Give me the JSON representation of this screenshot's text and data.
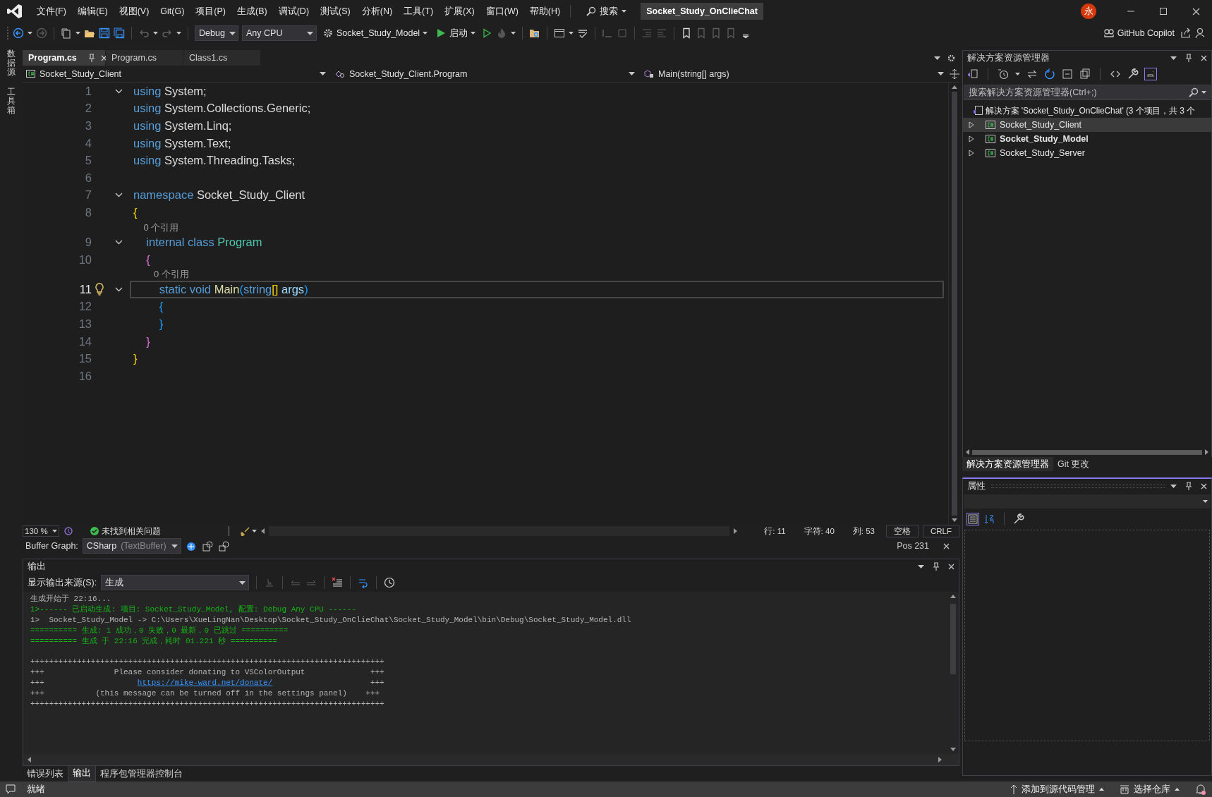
{
  "titlebar": {
    "menu": [
      "文件(F)",
      "编辑(E)",
      "视图(V)",
      "Git(G)",
      "项目(P)",
      "生成(B)",
      "调试(D)",
      "测试(S)",
      "分析(N)",
      "工具(T)",
      "扩展(X)",
      "窗口(W)",
      "帮助(H)"
    ],
    "search": "搜索",
    "title": "Socket_Study_OnClieChat",
    "avatar": "永"
  },
  "toolbar": {
    "configuration": "Debug",
    "platform": "Any CPU",
    "startup_project": "Socket_Study_Model",
    "start": "启动",
    "copilot": "GitHub Copilot"
  },
  "side_tabs": [
    "数据源",
    "工具箱"
  ],
  "doc_tabs": [
    {
      "label": "Program.cs",
      "selected": true
    },
    {
      "label": "Program.cs",
      "selected": false
    },
    {
      "label": "Class1.cs",
      "selected": false
    }
  ],
  "nav": {
    "project": "Socket_Study_Client",
    "type": "Socket_Study_Client.Program",
    "member": "Main(string[] args)"
  },
  "editor": {
    "lines": [
      {
        "kind": "code",
        "number": "1",
        "fold": true,
        "current": false,
        "lightbulb": false,
        "tokens": [
          {
            "text": "using",
            "kind": "keyword"
          },
          {
            "text": " System;",
            "kind": "plain"
          }
        ]
      },
      {
        "kind": "code",
        "number": "2",
        "fold": false,
        "current": false,
        "lightbulb": false,
        "tokens": [
          {
            "text": "using",
            "kind": "keyword"
          },
          {
            "text": " System.Collections.Generic;",
            "kind": "plain"
          }
        ]
      },
      {
        "kind": "code",
        "number": "3",
        "fold": false,
        "current": false,
        "lightbulb": false,
        "tokens": [
          {
            "text": "using",
            "kind": "keyword"
          },
          {
            "text": " System.Linq;",
            "kind": "plain"
          }
        ]
      },
      {
        "kind": "code",
        "number": "4",
        "fold": false,
        "current": false,
        "lightbulb": false,
        "tokens": [
          {
            "text": "using",
            "kind": "keyword"
          },
          {
            "text": " System.Text;",
            "kind": "plain"
          }
        ]
      },
      {
        "kind": "code",
        "number": "5",
        "fold": false,
        "current": false,
        "lightbulb": false,
        "tokens": [
          {
            "text": "using",
            "kind": "keyword"
          },
          {
            "text": " System.Threading.Tasks;",
            "kind": "plain"
          }
        ]
      },
      {
        "kind": "code",
        "number": "6",
        "fold": false,
        "current": false,
        "lightbulb": false
      },
      {
        "kind": "code",
        "number": "7",
        "fold": true,
        "current": false,
        "lightbulb": false,
        "tokens": [
          {
            "text": "namespace",
            "kind": "keyword"
          },
          {
            "text": " Socket_Study_Client",
            "kind": "plain"
          }
        ]
      },
      {
        "kind": "code",
        "number": "8",
        "fold": false,
        "current": false,
        "lightbulb": false,
        "tokens": [
          {
            "text": "{",
            "kind": "brace1"
          }
        ]
      },
      {
        "kind": "codelens",
        "text": "    0 个引用"
      },
      {
        "kind": "code",
        "number": "9",
        "fold": true,
        "current": false,
        "lightbulb": false,
        "tokens": [
          {
            "text": "    internal class",
            "kind": "keyword"
          },
          {
            "text": " Program",
            "kind": "type"
          }
        ]
      },
      {
        "kind": "code",
        "number": "10",
        "fold": false,
        "current": false,
        "lightbulb": false,
        "tokens": [
          {
            "text": "    {",
            "kind": "brace2"
          }
        ]
      },
      {
        "kind": "codelens",
        "text": "        0 个引用"
      },
      {
        "kind": "code",
        "number": "11",
        "fold": true,
        "current": true,
        "lightbulb": true,
        "tokens": [
          {
            "text": "        static void",
            "kind": "keyword"
          },
          {
            "text": " Main",
            "kind": "method"
          },
          {
            "text": "(",
            "kind": "brace3"
          },
          {
            "text": "string",
            "kind": "keyword"
          },
          {
            "text": "[]",
            "kind": "brace1"
          },
          {
            "text": " args",
            "kind": "param"
          },
          {
            "text": ")",
            "kind": "brace3"
          }
        ]
      },
      {
        "kind": "code",
        "number": "12",
        "fold": false,
        "current": false,
        "lightbulb": false,
        "tokens": [
          {
            "text": "        {",
            "kind": "brace3"
          }
        ]
      },
      {
        "kind": "code",
        "number": "13",
        "fold": false,
        "current": false,
        "lightbulb": false,
        "tokens": [
          {
            "text": "        }",
            "kind": "brace3"
          }
        ]
      },
      {
        "kind": "code",
        "number": "14",
        "fold": false,
        "current": false,
        "lightbulb": false,
        "tokens": [
          {
            "text": "    }",
            "kind": "brace2"
          }
        ]
      },
      {
        "kind": "code",
        "number": "15",
        "fold": false,
        "current": false,
        "lightbulb": false,
        "tokens": [
          {
            "text": "}",
            "kind": "brace1"
          }
        ]
      },
      {
        "kind": "code",
        "number": "16",
        "fold": false,
        "current": false,
        "lightbulb": false
      }
    ]
  },
  "editor_status": {
    "zoom": "130 %",
    "issues": "未找到相关问题",
    "line": "行: 11",
    "char": "字符: 40",
    "col": "列: 53",
    "whitespace": "空格",
    "line_ending": "CRLF"
  },
  "buffer_graph": {
    "label": "Buffer Graph:",
    "value": "CSharp",
    "detail": "(TextBuffer)",
    "position": "Pos 231"
  },
  "output": {
    "title": "输出",
    "source_label": "显示输出来源(S):",
    "source": "生成",
    "lines": [
      {
        "kind": "text",
        "segments": [
          {
            "text": "生成开始于 22:16...",
            "kind": "plain"
          }
        ]
      },
      {
        "kind": "text",
        "segments": [
          {
            "text": "1>------ 已启动生成: 项目: Socket_Study_Model, 配置: Debug Any CPU ------",
            "kind": "success"
          }
        ]
      },
      {
        "kind": "text",
        "segments": [
          {
            "text": "1>  Socket_Study_Model -> C:\\Users\\XueLingNan\\Desktop\\Socket_Study_OnClieChat\\Socket_Study_Model\\bin\\Debug\\Socket_Study_Model.dll",
            "kind": "plain"
          }
        ]
      },
      {
        "kind": "text",
        "segments": [
          {
            "text": "========== 生成: 1 成功，0 失败，0 最新，0 已跳过 ==========",
            "kind": "success"
          }
        ]
      },
      {
        "kind": "text",
        "segments": [
          {
            "text": "========== 生成 于 22:16 完成，耗时 01.221 秒 ==========",
            "kind": "success"
          }
        ]
      },
      {
        "kind": "blank"
      },
      {
        "kind": "text",
        "segments": [
          {
            "text": "++++++++++++++++++++++++++++++++++++++++++++++++++++++++++++++++++++++++++++",
            "kind": "plain"
          }
        ]
      },
      {
        "kind": "text",
        "segments": [
          {
            "text": "+++               Please consider donating to VSColorOutput              +++",
            "kind": "plain"
          }
        ]
      },
      {
        "kind": "text",
        "segments": [
          {
            "text": "+++                    ",
            "kind": "plain"
          },
          {
            "text": "https://mike-ward.net/donate/",
            "kind": "link"
          },
          {
            "text": "                     +++",
            "kind": "plain"
          }
        ]
      },
      {
        "kind": "text",
        "segments": [
          {
            "text": "+++           (this message can be turned off in the settings panel)    +++",
            "kind": "plain"
          }
        ]
      },
      {
        "kind": "text",
        "segments": [
          {
            "text": "++++++++++++++++++++++++++++++++++++++++++++++++++++++++++++++++++++++++++++",
            "kind": "plain"
          }
        ]
      }
    ]
  },
  "bottom_tabs": [
    {
      "label": "错误列表",
      "selected": false
    },
    {
      "label": "输出",
      "selected": true
    },
    {
      "label": "程序包管理器控制台",
      "selected": false
    }
  ],
  "solution_explorer": {
    "title": "解决方案资源管理器",
    "search_placeholder": "搜索解决方案资源管理器(Ctrl+;)",
    "solution": "解决方案 'Socket_Study_OnClieChat' (3 个项目，共 3 个",
    "projects": [
      {
        "name": "Socket_Study_Client",
        "selected": true,
        "startup": false,
        "expanded": false
      },
      {
        "name": "Socket_Study_Model",
        "selected": false,
        "startup": true,
        "expanded": false
      },
      {
        "name": "Socket_Study_Server",
        "selected": false,
        "startup": false,
        "expanded": false
      }
    ],
    "tabs": [
      {
        "label": "解决方案资源管理器",
        "selected": true
      },
      {
        "label": "Git 更改",
        "selected": false
      }
    ]
  },
  "properties": {
    "title": "属性"
  },
  "status_bar": {
    "ready": "就绪",
    "source_control": "添加到源代码管理",
    "repository": "选择仓库"
  }
}
